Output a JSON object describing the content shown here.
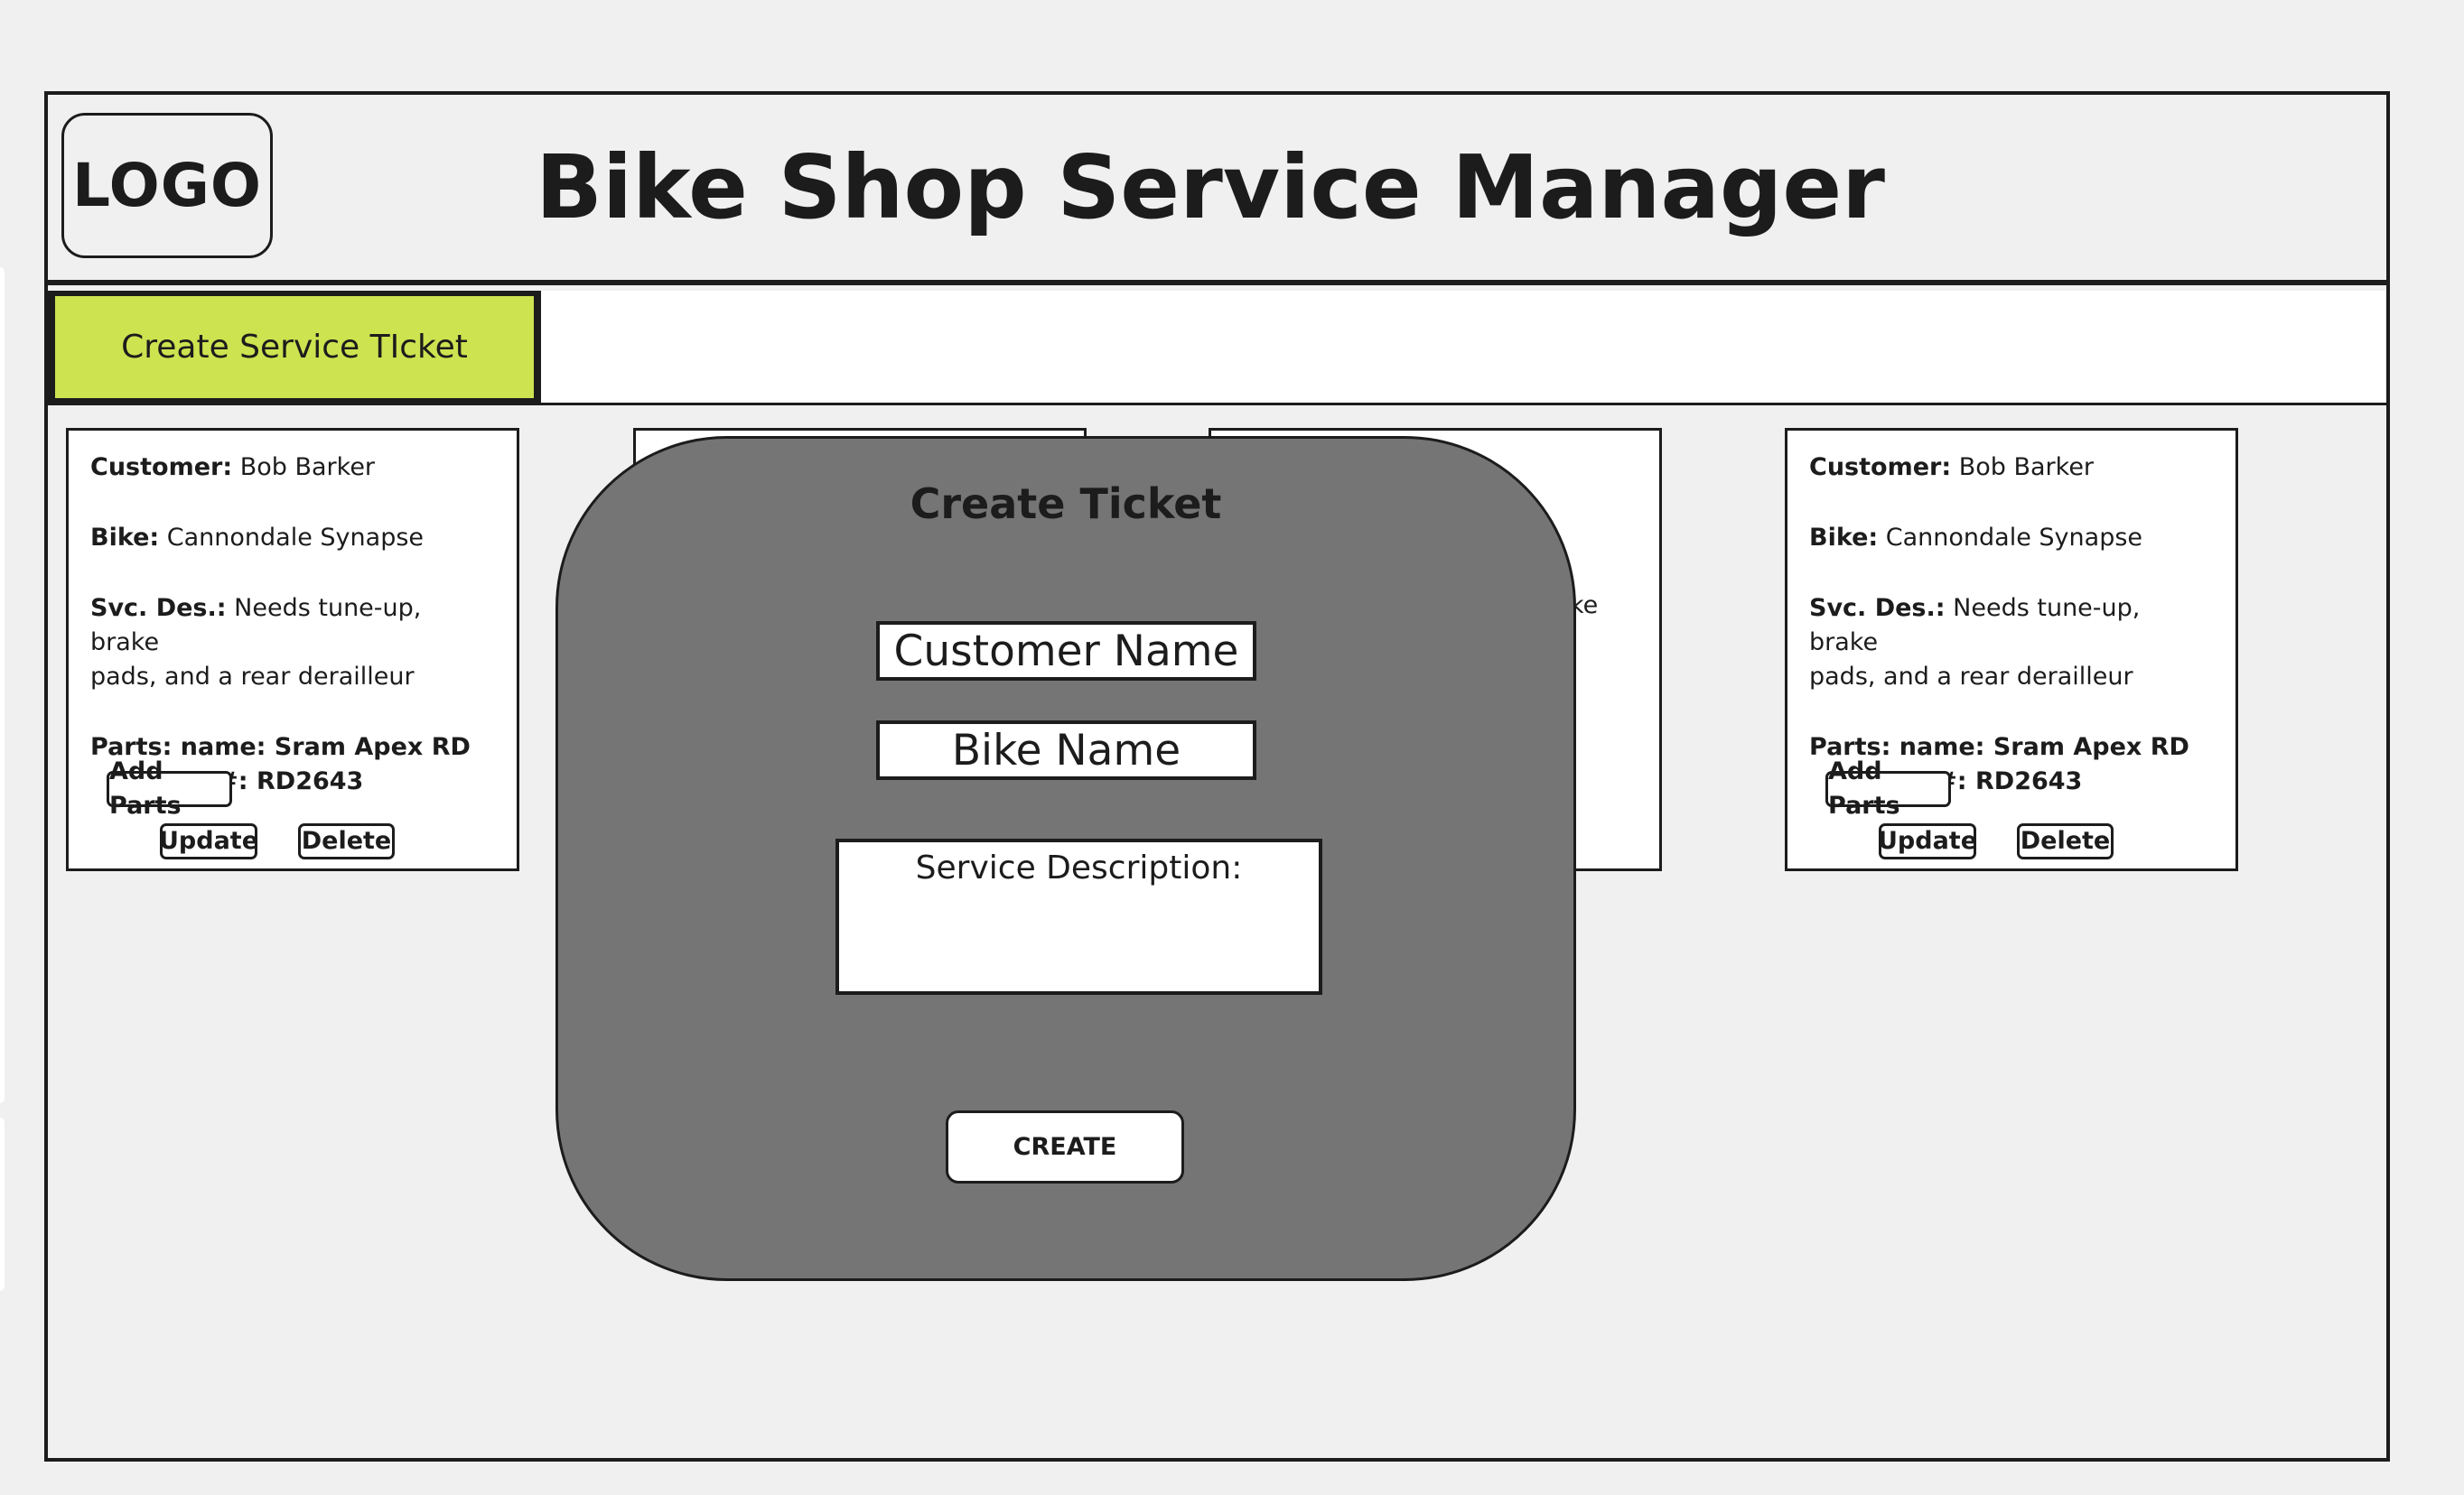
{
  "header": {
    "logo": "LOGO",
    "title": "Bike Shop Service Manager"
  },
  "toolbar": {
    "create_ticket_label": "Create Service TIcket"
  },
  "tickets": [
    {
      "customer_label": "Customer:",
      "customer": "Bob Barker",
      "bike_label": "Bike:",
      "bike": "Cannondale Synapse",
      "svc_label": "Svc. Des.:",
      "svc_line1": "Needs tune-up, brake",
      "svc_line2": "pads, and a rear derailleur",
      "parts_name": "Parts: name: Sram Apex RD",
      "parts_number": "part #: RD2643",
      "add_parts_label": "Add Parts",
      "update_label": "Update",
      "delete_label": "Delete"
    },
    {
      "svc_fragment": "ke"
    },
    {
      "customer_label": "Customer:",
      "customer": "Bob Barker",
      "bike_label": "Bike:",
      "bike": "Cannondale Synapse",
      "svc_label": "Svc. Des.:",
      "svc_line1": "Needs tune-up, brake",
      "svc_line2": "pads, and a rear derailleur",
      "parts_name": "Parts: name: Sram Apex RD",
      "parts_number": "part #: RD2643",
      "add_parts_label": "Add Parts",
      "update_label": "Update",
      "delete_label": "Delete"
    }
  ],
  "modal": {
    "title": "Create Ticket",
    "customer_name_placeholder": "Customer Name",
    "bike_name_placeholder": "Bike Name",
    "service_description_label": "Service Description:",
    "create_label": "CREATE"
  },
  "colors": {
    "accent": "#cde350",
    "modal_bg": "#757575",
    "page_bg": "#f0f0f0",
    "ink": "#1c1c1c"
  }
}
